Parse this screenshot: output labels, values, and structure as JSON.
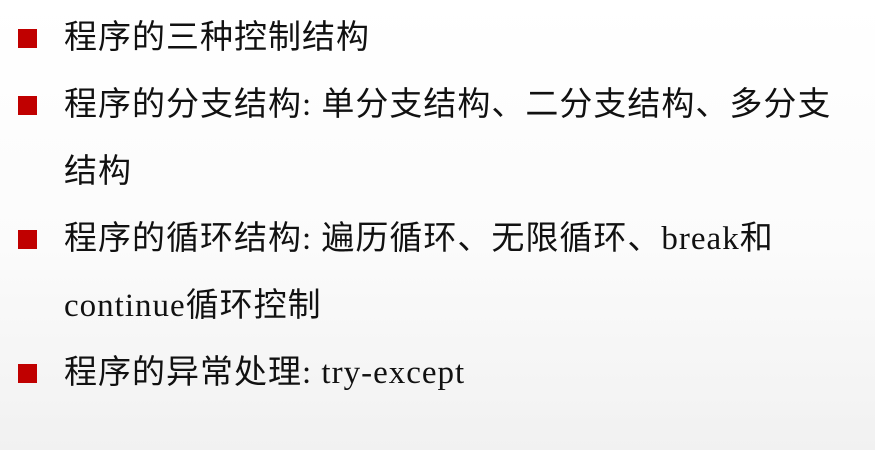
{
  "slide": {
    "bullets": [
      {
        "text": "程序的三种控制结构"
      },
      {
        "text": "程序的分支结构: 单分支结构、二分支结构、多分支结构"
      },
      {
        "text": "程序的循环结构: 遍历循环、无限循环、break和continue循环控制"
      },
      {
        "text": "程序的异常处理: try-except"
      }
    ],
    "colors": {
      "bullet_marker": "#c00000",
      "text": "#111111"
    }
  }
}
